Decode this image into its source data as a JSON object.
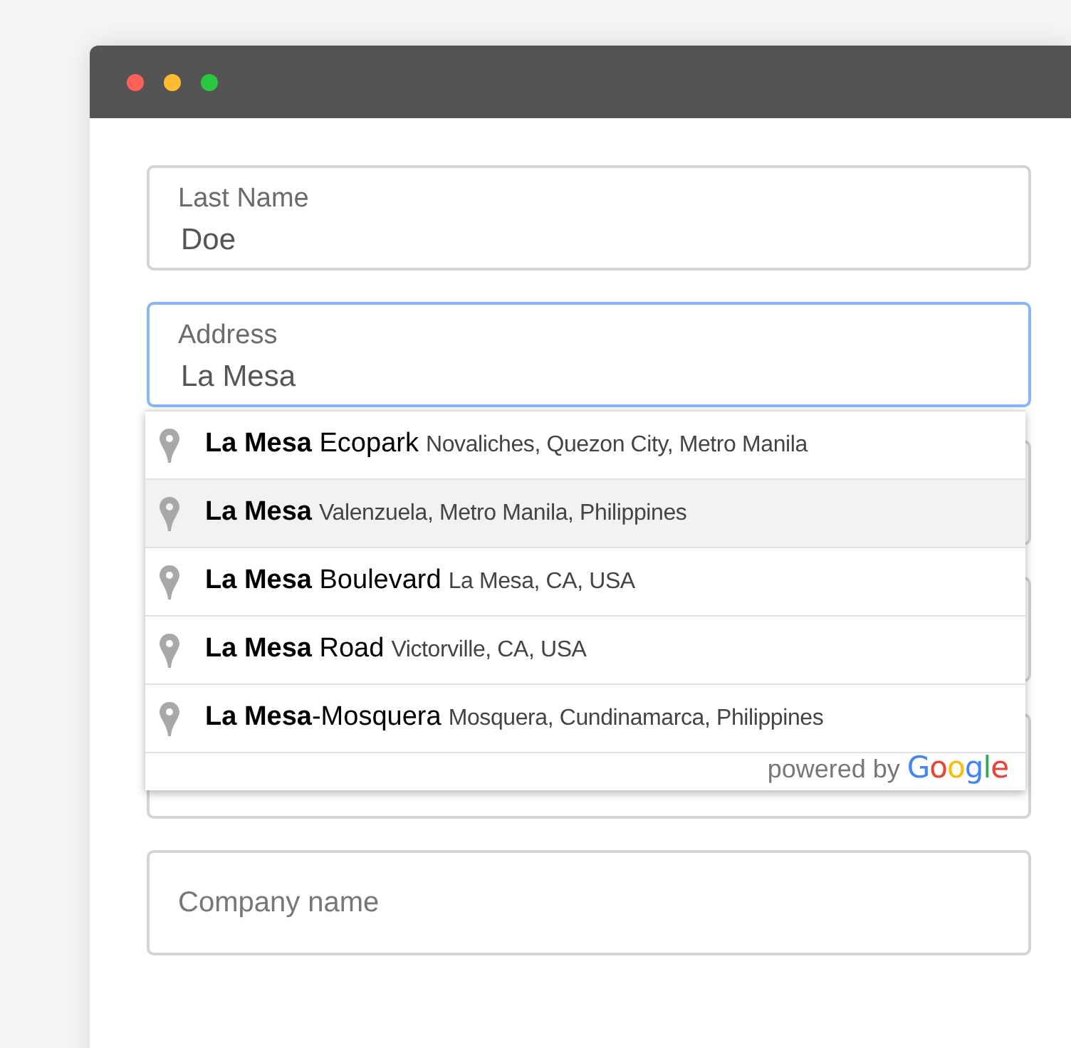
{
  "window": {
    "controls": [
      {
        "kind": "close"
      },
      {
        "kind": "minimize"
      },
      {
        "kind": "zoom"
      }
    ]
  },
  "fields": [
    {
      "label": "Last Name",
      "value": "Doe",
      "focused": false
    },
    {
      "label": "Address",
      "value": "La Mesa",
      "focused": true
    }
  ],
  "autocomplete": {
    "suggestions": [
      {
        "main": "**La Mesa** Ecopark",
        "secondary": "Novaliches, Quezon City, Metro Manila",
        "selected": false
      },
      {
        "main": "**La Mesa**",
        "secondary": "Valenzuela, Metro Manila, Philippines",
        "selected": true
      },
      {
        "main": "**La Mesa** Boulevard",
        "secondary": "La Mesa, CA, USA",
        "selected": false
      },
      {
        "main": "**La Mesa** Road",
        "secondary": "Victorville, CA, USA",
        "selected": false
      },
      {
        "main": "**La Mesa**-Mosquera",
        "secondary": "Mosquera, Cundinamarca, Philippines",
        "selected": false
      }
    ],
    "attribution": "powered by",
    "brand": "Google"
  },
  "company_field": {
    "placeholder": "Company name"
  }
}
